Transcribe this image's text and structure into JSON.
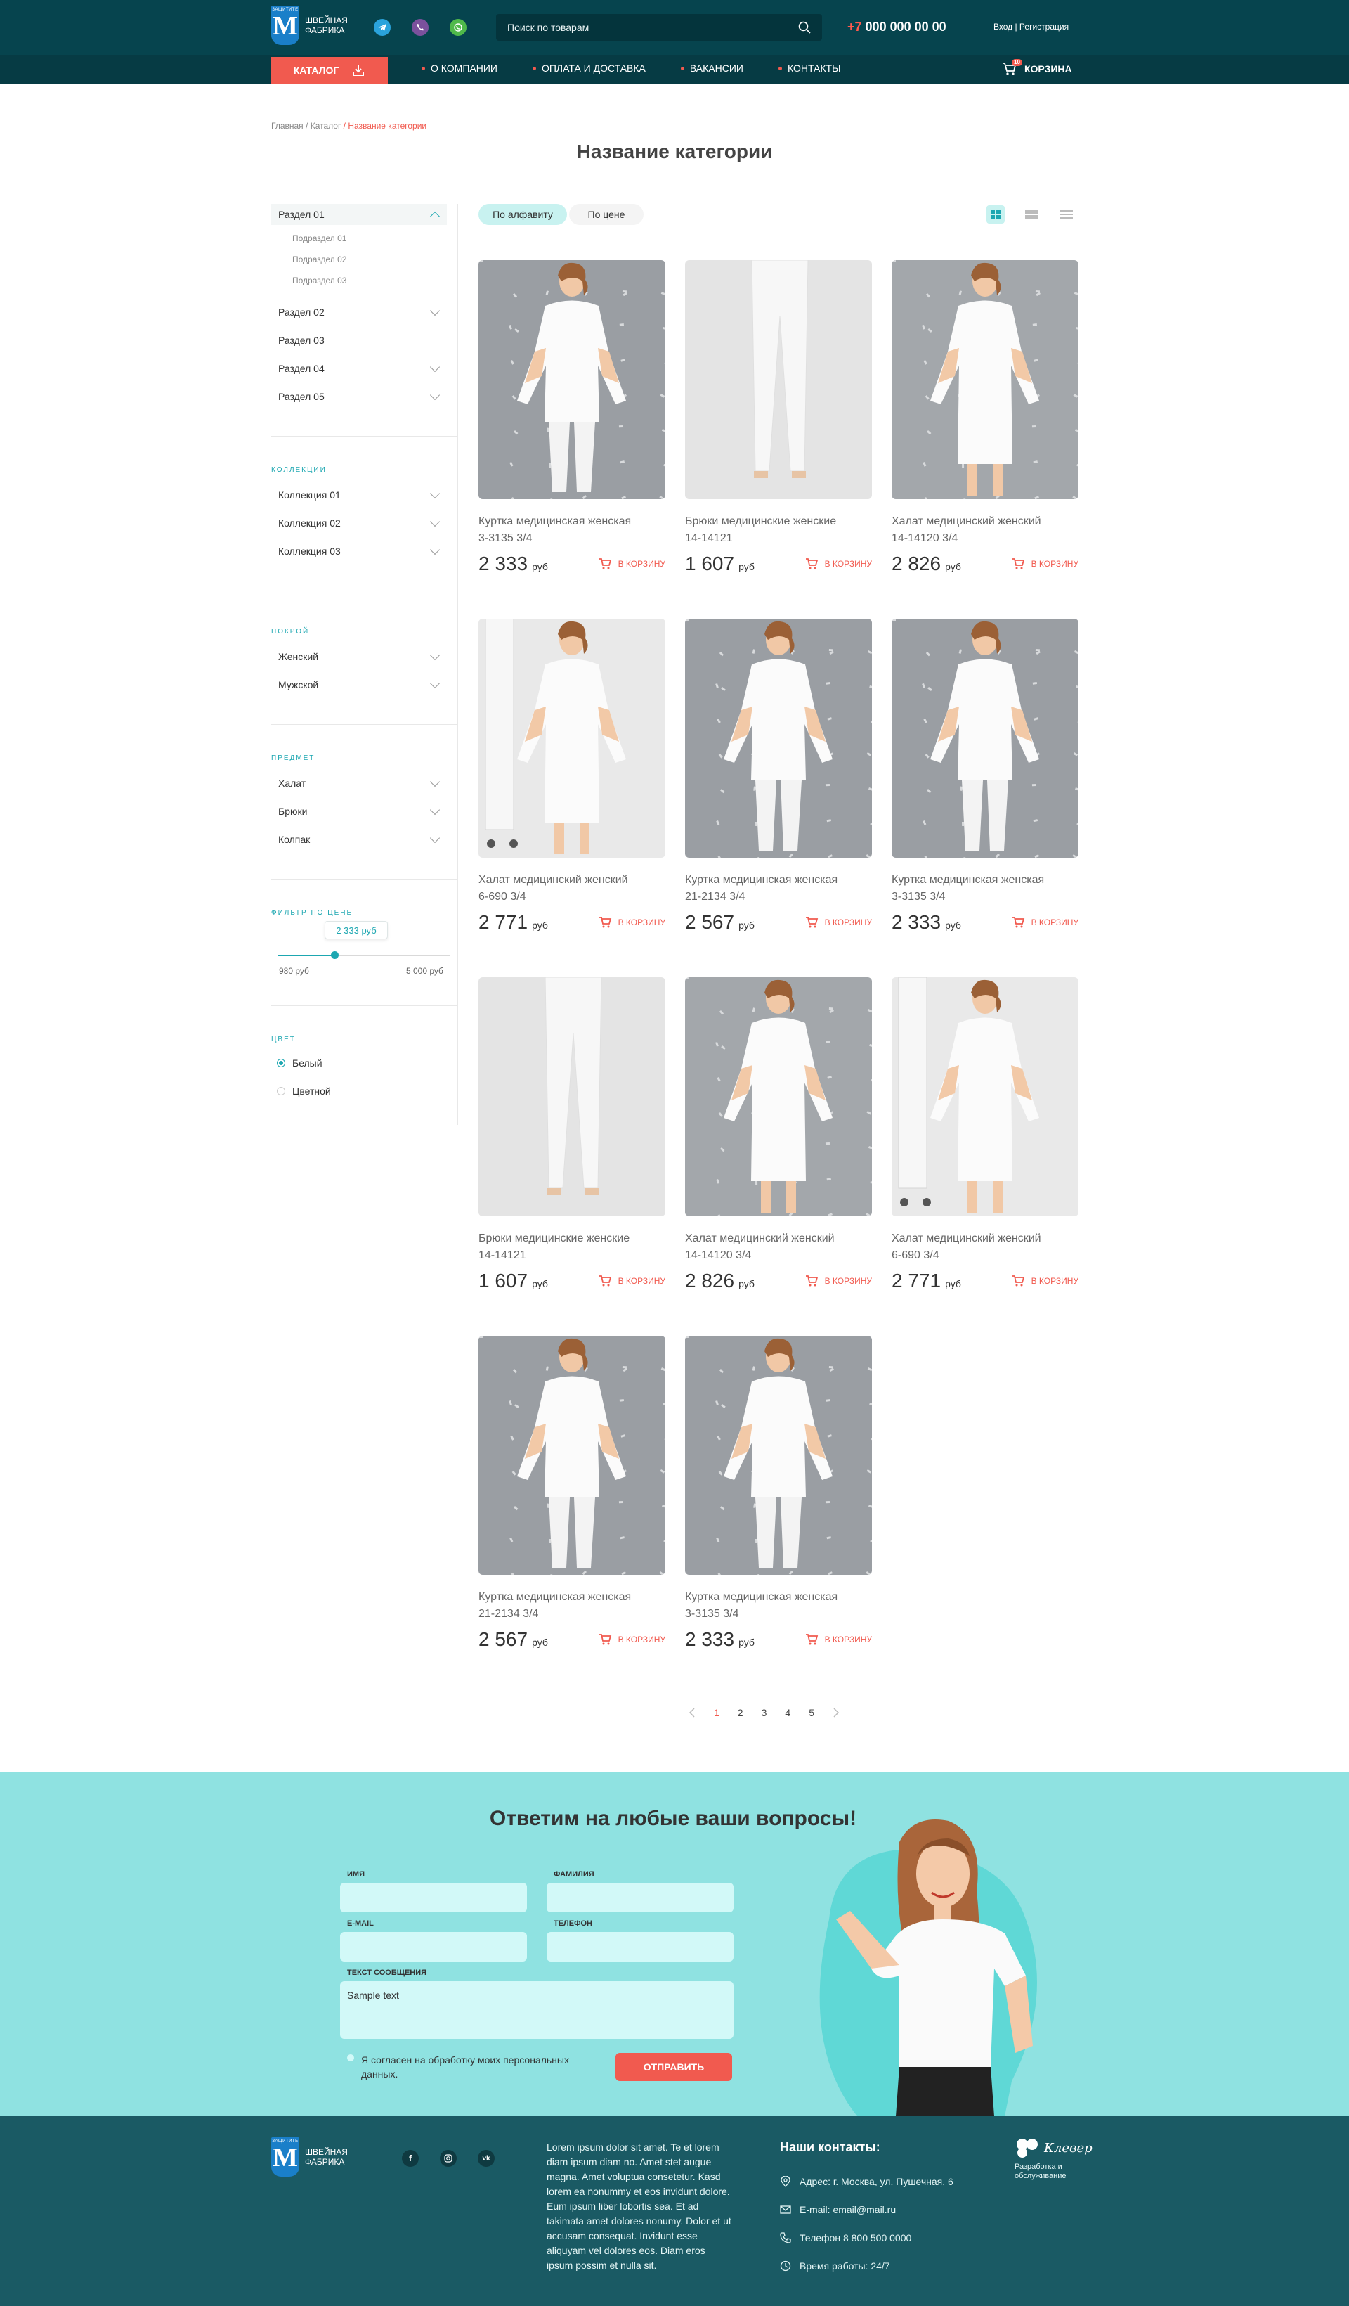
{
  "header": {
    "logo_small": "ЗАЩИТИТЕ",
    "logo_letter": "M",
    "logo_text_line1": "ШВЕЙНАЯ",
    "logo_text_line2": "ФАБРИКА",
    "search_placeholder": "Поиск по товарам",
    "phone_prefix": "+7",
    "phone_number": "000 000 00 00",
    "login": "Вход | Регистрация"
  },
  "nav": {
    "catalog": "КАТАЛОГ",
    "links": [
      "О КОМПАНИИ",
      "ОПЛАТА И ДОСТАВКА",
      "ВАКАНСИИ",
      "КОНТАКТЫ"
    ],
    "cart_label": "КОРЗИНА",
    "cart_count": "10"
  },
  "breadcrumb": {
    "home": "Главная",
    "catalog": "/ Каталог",
    "current": "/ Название категории"
  },
  "page_title": "Название категории",
  "sidebar": {
    "sections": [
      "Раздел 01",
      "Раздел 02",
      "Раздел 03",
      "Раздел 04",
      "Раздел 05"
    ],
    "subsections": [
      "Подраздел 01",
      "Подраздел 02",
      "Подраздел 03"
    ],
    "collections_head": "КОЛЛЕКЦИИ",
    "collections": [
      "Коллекция 01",
      "Коллекция 02",
      "Коллекция 03"
    ],
    "cut_head": "ПОКРОЙ",
    "cuts": [
      "Женский",
      "Мужской"
    ],
    "subject_head": "ПРЕДМЕТ",
    "subjects": [
      "Халат",
      "Брюки",
      "Колпак"
    ],
    "price_head": "ФИЛЬТР ПО ЦЕНЕ",
    "price_value": "2 333 руб",
    "price_min": "980 руб",
    "price_max": "5 000 руб",
    "price_level": 0.33,
    "color_head": "ЦВЕТ",
    "colors": [
      "Белый",
      "Цветной"
    ]
  },
  "sort": {
    "alpha": "По алфавиту",
    "price": "По цене"
  },
  "product_common": {
    "currency": "руб",
    "to_cart": "В КОРЗИНУ"
  },
  "products": [
    {
      "name1": "Куртка медицинская женская",
      "name2": "3-3135 3/4",
      "price": "2 333",
      "kind": "jacket"
    },
    {
      "name1": "Брюки медицинские женские",
      "name2": "14-14121",
      "price": "1 607",
      "kind": "pants"
    },
    {
      "name1": "Халат медицинский женский",
      "name2": "14-14120 3/4",
      "price": "2 826",
      "kind": "coat"
    },
    {
      "name1": "Халат медицинский женский",
      "name2": "6-690 3/4",
      "price": "2 771",
      "kind": "coat2"
    },
    {
      "name1": "Куртка медицинская женская",
      "name2": "21-2134 3/4",
      "price": "2 567",
      "kind": "jacket"
    },
    {
      "name1": "Куртка медицинская женская",
      "name2": "3-3135 3/4",
      "price": "2 333",
      "kind": "jacket"
    },
    {
      "name1": "Брюки медицинские женские",
      "name2": "14-14121",
      "price": "1 607",
      "kind": "pants"
    },
    {
      "name1": "Халат медицинский женский",
      "name2": "14-14120 3/4",
      "price": "2 826",
      "kind": "coat"
    },
    {
      "name1": "Халат медицинский женский",
      "name2": "6-690 3/4",
      "price": "2 771",
      "kind": "coat2"
    },
    {
      "name1": "Куртка медицинская женская",
      "name2": "21-2134 3/4",
      "price": "2 567",
      "kind": "jacket"
    },
    {
      "name1": "Куртка медицинская женская",
      "name2": "3-3135 3/4",
      "price": "2 333",
      "kind": "jacket"
    }
  ],
  "pagination": [
    "1",
    "2",
    "3",
    "4",
    "5"
  ],
  "contact_form": {
    "title": "Ответим на любые ваши вопросы!",
    "name_label": "ИМЯ",
    "surname_label": "ФАМИЛИЯ",
    "email_label": "E-MAIL",
    "phone_label": "ТЕЛЕФОН",
    "message_label": "ТЕКСТ СООБЩЕНИЯ",
    "message_value": "Sample text",
    "consent_line1": "Я согласен на обработку моих персональных",
    "consent_line2": "данных.",
    "submit": "ОТПРАВИТЬ"
  },
  "footer": {
    "lorem": "Lorem ipsum dolor sit amet. Te et lorem diam ipsum diam no. Amet stet augue magna. Amet voluptua consetetur. Kasd lorem ea nonummy et eos invidunt dolore. Eum ipsum liber lobortis sea. Et ad takimata amet dolores nonumy. Dolor et ut accusam consequat. Invidunt esse aliquyam vel dolores eos. Diam eros ipsum possim et nulla sit.",
    "contacts_title": "Наши контакты:",
    "address": "Адрес: г. Москва, ул. Пушечная, 6",
    "email": "E-mail: email@mail.ru",
    "phone": "Телефон 8 800 500 0000",
    "hours": "Время работы: 24/7",
    "dev_brand": "Клевер",
    "dev_line1": "Разработка и",
    "dev_line2": "обслуживание",
    "social": [
      "facebook-icon",
      "instagram-icon",
      "vk-icon"
    ]
  },
  "colors": {
    "accent": "#f15a4f",
    "teal": "#1da7b1",
    "header_bg": "#06444e",
    "contact_bg": "#8fe2e1",
    "footer_bg": "#1a5a64"
  }
}
